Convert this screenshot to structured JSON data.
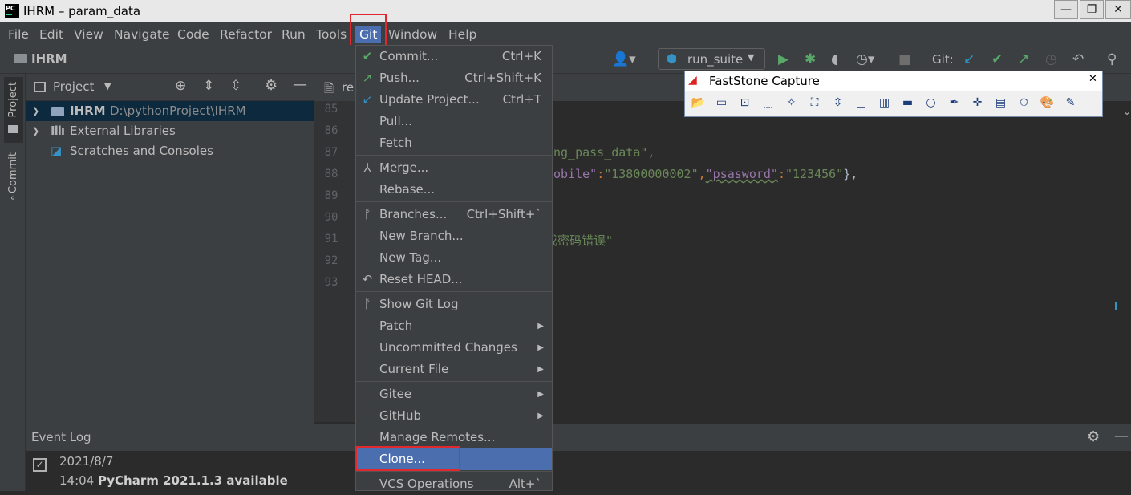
{
  "window": {
    "title": "IHRM – param_data",
    "app_icon_text": "PC",
    "minimize": "—",
    "restore": "❐",
    "close": "✕"
  },
  "menubar": {
    "items": [
      "File",
      "Edit",
      "View",
      "Navigate",
      "Code",
      "Refactor",
      "Run",
      "Tools",
      "Git",
      "Window",
      "Help"
    ],
    "active": "Git"
  },
  "toolbar": {
    "project_name": "IHRM",
    "run_config": "run_suite",
    "git_label": "Git:"
  },
  "side_tabs": {
    "project": "Project",
    "commit": "Commit"
  },
  "project_panel": {
    "title": "Project",
    "tree": [
      {
        "name": "IHRM",
        "path": "D:\\pythonProject\\IHRM",
        "icon": "folder-icon"
      },
      {
        "name": "External Libraries",
        "icon": "libraries-icon"
      },
      {
        "name": "Scratches and Consoles",
        "icon": "scratches-icon"
      }
    ]
  },
  "editor": {
    "tab_label": "re",
    "line_numbers": [
      "85",
      "86",
      "87",
      "88",
      "89",
      "90",
      "91",
      "92",
      "93"
    ],
    "line87": "ng_pass_data\",",
    "line88_a": "obile\"",
    "line88_b": ":",
    "line88_c": "\"13800000002\"",
    "line88_d": ",",
    "line88_e": "\"psasword\"",
    "line88_f": ":",
    "line88_g": "\"123456\"",
    "line88_h": "},",
    "line91": "或密码错误\""
  },
  "git_menu": {
    "items": [
      {
        "label": "Commit...",
        "shortcut": "Ctrl+K",
        "icon": "check-icon",
        "icon_glyph": "✔",
        "icon_color": "#59a869"
      },
      {
        "label": "Push...",
        "shortcut": "Ctrl+Shift+K",
        "icon": "push-arrow-icon",
        "icon_glyph": "↗",
        "icon_color": "#59a869"
      },
      {
        "label": "Update Project...",
        "shortcut": "Ctrl+T",
        "icon": "update-arrow-icon",
        "icon_glyph": "↙",
        "icon_color": "#3592c4"
      },
      {
        "label": "Pull...",
        "shortcut": ""
      },
      {
        "label": "Fetch",
        "shortcut": ""
      },
      {
        "label": "Merge...",
        "shortcut": "",
        "icon": "merge-icon",
        "icon_glyph": "⅄",
        "icon_color": "#afb1b3"
      },
      {
        "label": "Rebase...",
        "shortcut": ""
      },
      {
        "label": "Branches...",
        "shortcut": "Ctrl+Shift+`",
        "icon": "branch-icon",
        "icon_glyph": "ᚠ",
        "icon_color": "#afb1b3"
      },
      {
        "label": "New Branch...",
        "shortcut": ""
      },
      {
        "label": "New Tag...",
        "shortcut": ""
      },
      {
        "label": "Reset HEAD...",
        "shortcut": "",
        "icon": "undo-icon",
        "icon_glyph": "↶",
        "icon_color": "#afb1b3"
      },
      {
        "label": "Show Git Log",
        "shortcut": "",
        "icon": "git-log-icon",
        "icon_glyph": "ᚠ",
        "icon_color": "#afb1b3"
      },
      {
        "label": "Patch",
        "submenu": true
      },
      {
        "label": "Uncommitted Changes",
        "submenu": true
      },
      {
        "label": "Current File",
        "submenu": true
      },
      {
        "label": "Gitee",
        "submenu": true
      },
      {
        "label": "GitHub",
        "submenu": true
      },
      {
        "label": "Manage Remotes...",
        "shortcut": ""
      },
      {
        "label": "Clone...",
        "shortcut": "",
        "highlighted": true
      },
      {
        "label": "VCS Operations",
        "shortcut": "Alt+`"
      }
    ]
  },
  "faststone": {
    "title": "FastStone Capture",
    "min": "—",
    "close": "✕",
    "tools": [
      "open-icon",
      "window-icon",
      "object-icon",
      "rectangle-icon",
      "freehand-icon",
      "fullscreen-icon",
      "scrolling-icon",
      "fixed-region-icon",
      "video-icon",
      "ruler-bar-icon",
      "magnifier-icon",
      "color-picker-icon",
      "crosshair-icon",
      "ruler-icon",
      "timer-icon",
      "palette-icon",
      "brush-icon"
    ]
  },
  "event_log": {
    "title": "Event Log",
    "date": "2021/8/7",
    "time": "14:04",
    "message": "PyCharm 2021.1.3 available"
  },
  "colors": {
    "accent": "#4b6eaf",
    "highlight_box": "#e0282e",
    "string": "#6a8759",
    "key": "#9876aa"
  }
}
